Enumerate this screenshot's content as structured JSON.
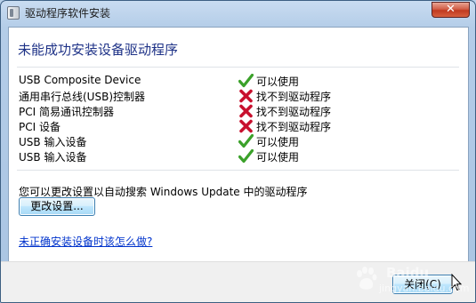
{
  "window": {
    "title": "驱动程序软件安装",
    "close_glyph": "✕"
  },
  "main": {
    "heading": "未能成功安装设备驱动程序",
    "devices": [
      {
        "name": "USB Composite Device",
        "status": "可以使用",
        "state": "ok"
      },
      {
        "name": "通用串行总线(USB)控制器",
        "status": "找不到驱动程序",
        "state": "fail"
      },
      {
        "name": "PCI 简易通讯控制器",
        "status": "找不到驱动程序",
        "state": "fail"
      },
      {
        "name": "PCI 设备",
        "status": "找不到驱动程序",
        "state": "fail"
      },
      {
        "name": "USB 输入设备",
        "status": "可以使用",
        "state": "ok"
      },
      {
        "name": "USB 输入设备",
        "status": "可以使用",
        "state": "ok"
      }
    ],
    "note": "您可以更改设置以自动搜索 Windows Update 中的驱动程序",
    "change_settings_label": "更改设置...",
    "help_link": "未正确安装设备时该怎么做?"
  },
  "footer": {
    "close_label": "关闭(C)"
  },
  "watermark": {
    "text1": "Baidu",
    "text2": "jingyan.baidu.com"
  },
  "icons": {
    "ok": "green-check-icon",
    "fail": "red-x-icon"
  },
  "colors": {
    "heading": "#1e3287",
    "link": "#0033cc",
    "ok": "#3ba12a",
    "fail": "#c8102e"
  }
}
